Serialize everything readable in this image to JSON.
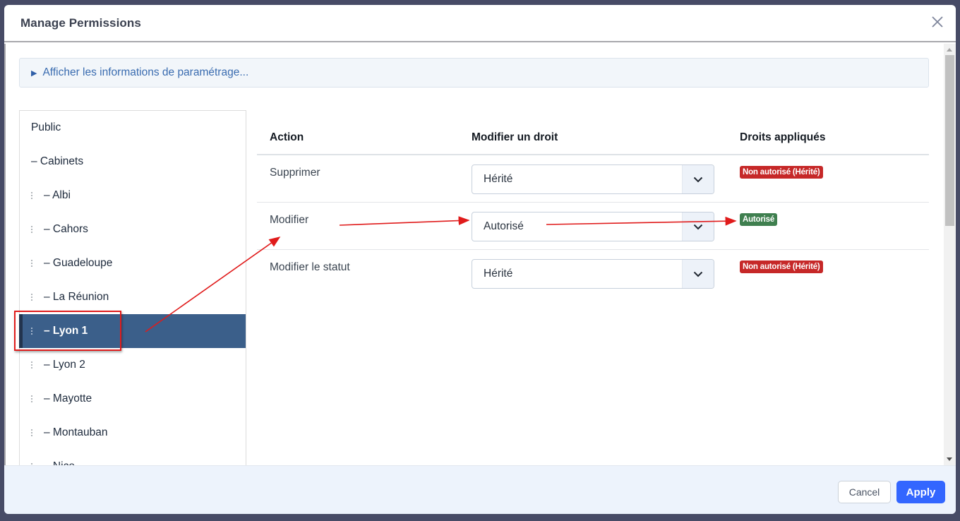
{
  "modal": {
    "title": "Manage Permissions",
    "close_icon": "close-x-icon"
  },
  "info_box": {
    "icon": "triangle-right-icon",
    "glyph": "▶",
    "label": "Afficher les informations de paramétrage..."
  },
  "tree": {
    "items": [
      {
        "label": "Public",
        "level": 0,
        "drag_handle": false,
        "selected": false
      },
      {
        "label": "– Cabinets",
        "level": 0,
        "drag_handle": false,
        "selected": false
      },
      {
        "label": "– Albi",
        "level": 1,
        "drag_handle": true,
        "selected": false
      },
      {
        "label": "– Cahors",
        "level": 1,
        "drag_handle": true,
        "selected": false
      },
      {
        "label": "– Guadeloupe",
        "level": 1,
        "drag_handle": true,
        "selected": false
      },
      {
        "label": "– La Réunion",
        "level": 1,
        "drag_handle": true,
        "selected": false
      },
      {
        "label": "– Lyon 1",
        "level": 1,
        "drag_handle": true,
        "selected": true
      },
      {
        "label": "– Lyon 2",
        "level": 1,
        "drag_handle": true,
        "selected": false
      },
      {
        "label": "– Mayotte",
        "level": 1,
        "drag_handle": true,
        "selected": false
      },
      {
        "label": "– Montauban",
        "level": 1,
        "drag_handle": true,
        "selected": false
      },
      {
        "label": "– Nice",
        "level": 1,
        "drag_handle": true,
        "selected": false
      }
    ]
  },
  "table": {
    "headers": [
      "Action",
      "Modifier un droit",
      "Droits appliqués"
    ],
    "rows": [
      {
        "action": "Supprimer",
        "select_value": "Hérité",
        "applied": "Non autorisé (Hérité)",
        "applied_status": "denied"
      },
      {
        "action": "Modifier",
        "select_value": "Autorisé",
        "applied": "Autorisé",
        "applied_status": "allowed"
      },
      {
        "action": "Modifier le statut",
        "select_value": "Hérité",
        "applied": "Non autorisé (Hérité)",
        "applied_status": "denied"
      }
    ]
  },
  "footer": {
    "cancel_label": "Cancel",
    "apply_label": "Apply"
  },
  "colors": {
    "accent": "#3366ff",
    "selected_row": "#3b5f8a",
    "denied_badge": "#c62828",
    "allowed_badge": "#3f7f4f",
    "annotation": "#e01b1b"
  }
}
